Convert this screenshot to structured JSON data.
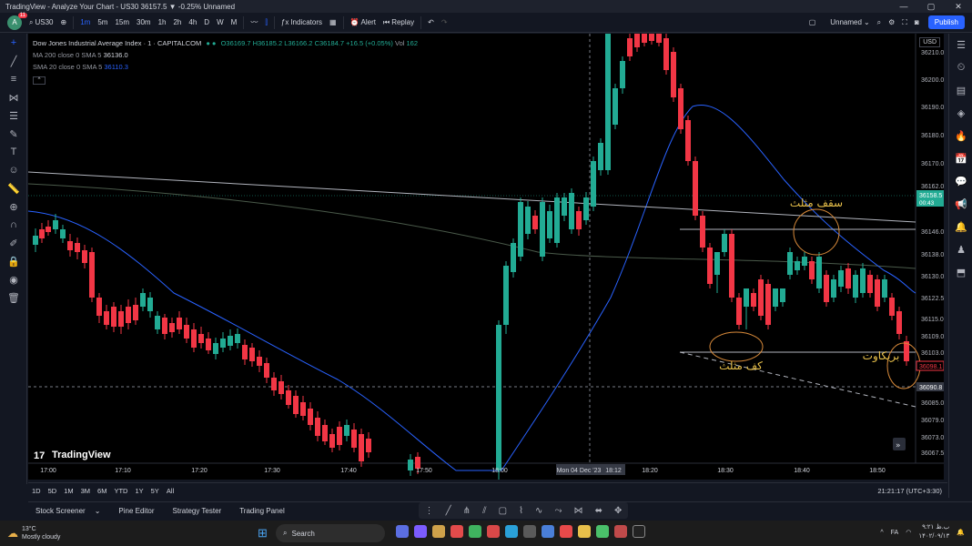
{
  "window": {
    "title": "TradingView - Analyze Your Chart - US30 36157.5 ▼ -0.25% Unnamed",
    "controls": [
      "—",
      "▢",
      "✕"
    ]
  },
  "toolbar": {
    "avatar_letter": "A",
    "avatar_badge": "11",
    "symbol": "US30",
    "intervals": [
      "1m",
      "5m",
      "15m",
      "30m",
      "1h",
      "2h",
      "4h",
      "D",
      "W",
      "M"
    ],
    "active_interval": "1m",
    "indicators_label": "Indicators",
    "alert_label": "Alert",
    "replay_label": "Replay",
    "layout_name": "Unnamed",
    "publish_label": "Publish"
  },
  "legend": {
    "symbol_line": "Dow Jones Industrial Average Index · 1 · CAPITALCOM",
    "ohlc": "O36169.7 H36185.2 L36166.2 C36184.7 +16.5 (+0.05%)",
    "vol_label": "Vol",
    "vol_value": "162",
    "ma_label": "MA 200 close 0 SMA 5",
    "ma_value": "36136.0",
    "sma_label": "SMA 20 close 0 SMA 5",
    "sma_value": "36110.3",
    "collapse_glyph": "^"
  },
  "currency": "USD",
  "price_axis": [
    "36200.0",
    "36190.0",
    "36180.0",
    "36170.0",
    "36162.0",
    "36146.0",
    "36138.0",
    "36130.0",
    "36122.5",
    "36115.0",
    "36109.0",
    "36103.0",
    "36098.0",
    "36090.8",
    "36085.0",
    "36079.0",
    "36073.0",
    "36067.5",
    "36210.0"
  ],
  "price_badges": {
    "current": "36158.5",
    "countdown": "00:43",
    "crosshair": "36090.8",
    "red": "36098.1"
  },
  "time_axis": [
    "17:00",
    "17:10",
    "17:20",
    "17:30",
    "17:40",
    "17:50",
    "18:00",
    "Mon 04 Dec '23",
    "18:12",
    "18:20",
    "18:30",
    "18:40",
    "18:50"
  ],
  "annotations": {
    "top": "سقف مثلث",
    "bottom": "کف مثلث",
    "breakout": "بریکاوت"
  },
  "watermark": "TradingView",
  "ranges": [
    "1D",
    "5D",
    "1M",
    "3M",
    "6M",
    "YTD",
    "1Y",
    "5Y",
    "All"
  ],
  "clock": "21:21:17 (UTC+3:30)",
  "panels": [
    "Stock Screener",
    "Pine Editor",
    "Strategy Tester",
    "Trading Panel"
  ],
  "taskbar": {
    "temp": "13°C",
    "weather": "Mostly cloudy",
    "search": "Search",
    "lang": "FA",
    "time": "۹:۲۱ ب.ظ",
    "date": "۱۴۰۲/۰۹/۱۳"
  },
  "colors": {
    "up": "#22ab94",
    "down": "#f23645",
    "sma20": "#2962ff",
    "ma200": "#4a5a4a",
    "trendline": "#b2b5be",
    "annotation": "#d88a3a"
  }
}
